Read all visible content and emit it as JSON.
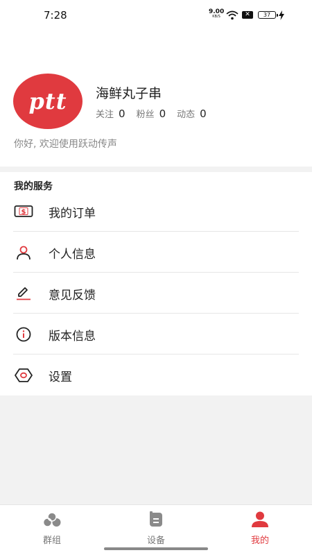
{
  "status_bar": {
    "time": "7:28",
    "speed_value": "9.00",
    "speed_unit": "KB/S",
    "battery": "37"
  },
  "profile": {
    "avatar_text": "ptt",
    "username": "海鲜丸子串",
    "stats": [
      {
        "label": "关注",
        "value": "0"
      },
      {
        "label": "粉丝",
        "value": "0"
      },
      {
        "label": "动态",
        "value": "0"
      }
    ],
    "greeting": "你好, 欢迎使用跃动传声"
  },
  "services": {
    "title": "我的服务",
    "items": [
      {
        "label": "我的订单",
        "icon": "order-dollar-icon"
      },
      {
        "label": "个人信息",
        "icon": "person-icon"
      },
      {
        "label": "意见反馈",
        "icon": "pencil-feedback-icon"
      },
      {
        "label": "版本信息",
        "icon": "info-circle-icon"
      },
      {
        "label": "设置",
        "icon": "settings-hexagon-icon"
      }
    ]
  },
  "tabbar": {
    "tabs": [
      {
        "label": "群组",
        "icon": "group-icon",
        "active": false
      },
      {
        "label": "设备",
        "icon": "device-icon",
        "active": false
      },
      {
        "label": "我的",
        "icon": "me-icon",
        "active": true
      }
    ]
  },
  "colors": {
    "accent": "#e03a3f",
    "text": "#222222",
    "muted": "#888888",
    "background": "#f2f2f2"
  }
}
